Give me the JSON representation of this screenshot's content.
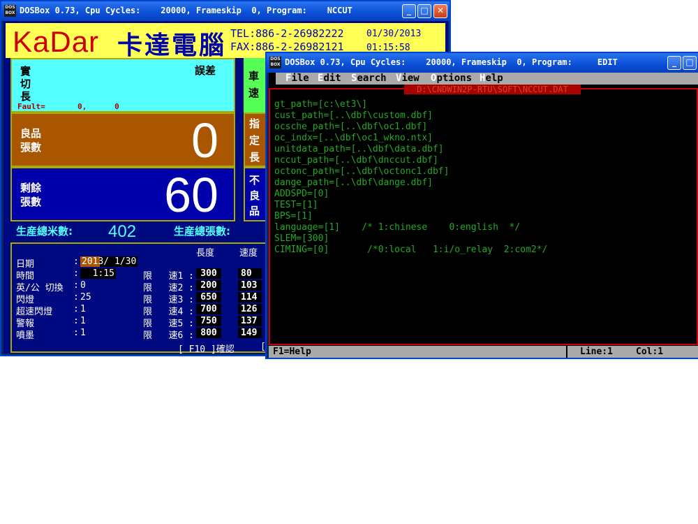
{
  "win1": {
    "title": "DOSBox 0.73, Cpu Cycles:    20000, Frameskip  0, Program:    NCCUT",
    "icon": "DOS BOX",
    "header": {
      "logo": "KaDar",
      "company_cn": "卡達電腦",
      "tel": "TEL:886-2-26982222",
      "fax": "FAX:886-2-26982121",
      "date": "01/30/2013",
      "time": "01:15:58"
    },
    "cut_panel": {
      "label": "實切長",
      "error_label": "誤差",
      "fault": "Fault=       0,      0"
    },
    "good_panel": {
      "label": "良品\n張數",
      "value": "0"
    },
    "remain_panel": {
      "label": "剩餘\n張數",
      "value": "60"
    },
    "side_labels": [
      "車\n速",
      "指\n定\n長",
      "不\n良\n品"
    ],
    "production": {
      "meters_label": "生産總米數:",
      "meters_value": "402",
      "sheets_label": "生産總張數:"
    },
    "settings": {
      "col_length": "長度",
      "col_speed": "速度",
      "rows": [
        {
          "label": "日期",
          "value": "2013/ 1/30"
        },
        {
          "label": "時間",
          "value": "  1:15"
        },
        {
          "label": "英/公 切換",
          "value": "0"
        },
        {
          "label": "閃燈",
          "value": "25"
        },
        {
          "label": "超速閃燈",
          "value": "1"
        },
        {
          "label": "警報",
          "value": "1"
        },
        {
          "label": "噴墨",
          "value": "1"
        }
      ],
      "limits": [
        {
          "label": "限   速1 :",
          "length": "300",
          "speed": "80"
        },
        {
          "label": "限   速2 :",
          "length": "200",
          "speed": "103"
        },
        {
          "label": "限   速3 :",
          "length": "650",
          "speed": "114"
        },
        {
          "label": "限   速4 :",
          "length": "700",
          "speed": "126"
        },
        {
          "label": "限   速5 :",
          "length": "750",
          "speed": "137"
        },
        {
          "label": "限   速6 :",
          "length": "800",
          "speed": "149"
        }
      ],
      "footer": "[ F10 ]確認"
    }
  },
  "win2": {
    "title": "DOSBox 0.73, Cpu Cycles:    20000, Frameskip  0, Program:     EDIT",
    "menu": [
      "File",
      "Edit",
      "Search",
      "View",
      "Options",
      "Help"
    ],
    "file_path": "D:\\CNDWIN2P-RTU\\SOFT\\NCCUT.DAT",
    "lines": [
      "gt_path=[c:\\et3\\]",
      "cust_path=[..\\dbf\\custom.dbf]",
      "ocsche_path=[..\\dbf\\oc1.dbf]",
      "oc_indx=[..\\dbf\\oc1_wkno.ntx]",
      "unitdata_path=[..\\dbf\\data.dbf]",
      "nccut_path=[..\\dbf\\dnccut.dbf]",
      "octonc_path=[..\\dbf\\octonc1.dbf]",
      "dange_path=[..\\dbf\\dange.dbf]",
      "ADDSPD=[0]",
      "TEST=[1]",
      "BPS=[1]",
      "language=[1]    /* 1:chinese    0:english  */",
      "SLEM=[300]",
      "CIMING=[0]       /*0:local   1:i/o_relay  2:com2*/"
    ],
    "status": {
      "help": "F1=Help",
      "line": "Line:1",
      "col": "Col:1"
    }
  },
  "colors": {
    "title_blue": "#0a4fd6",
    "panel_cyan": "#55ffff",
    "panel_brown": "#aa5500",
    "panel_blue": "#0000aa",
    "panel_green": "#55ff55",
    "header_yellow": "#ffff55",
    "edit_green": "#22aa22"
  }
}
